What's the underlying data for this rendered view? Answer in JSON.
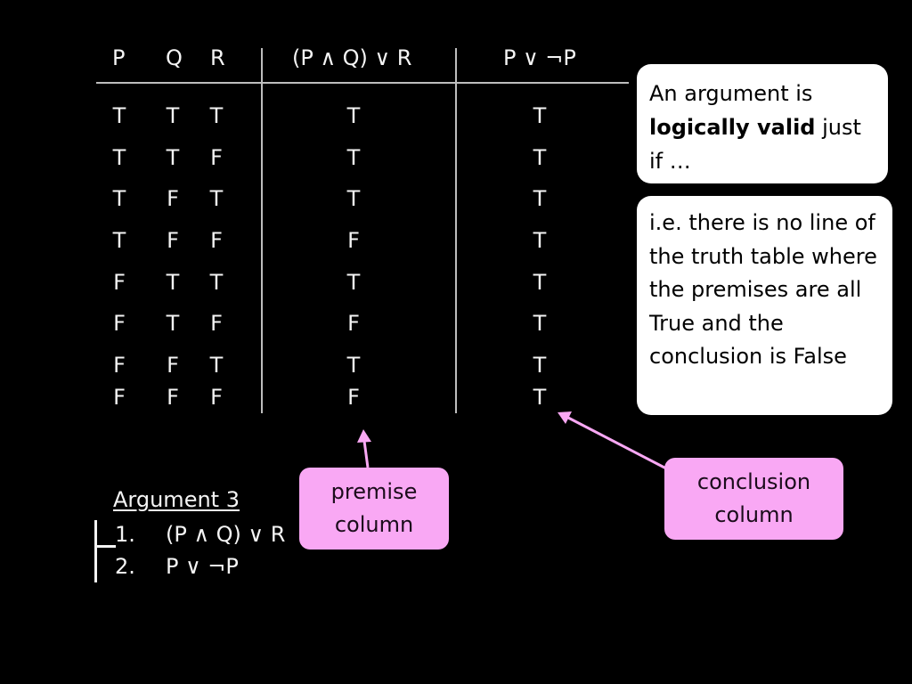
{
  "table": {
    "headers": {
      "p": "P",
      "q": "Q",
      "r": "R",
      "premise": "(P ∧ Q) ∨ R",
      "conclusion": "P ∨ ¬P"
    },
    "rows": [
      {
        "p": "T",
        "q": "T",
        "r": "T",
        "premise": "T",
        "conclusion": "T"
      },
      {
        "p": "T",
        "q": "T",
        "r": "F",
        "premise": "T",
        "conclusion": "T"
      },
      {
        "p": "T",
        "q": "F",
        "r": "T",
        "premise": "T",
        "conclusion": "T"
      },
      {
        "p": "T",
        "q": "F",
        "r": "F",
        "premise": "F",
        "conclusion": "T"
      },
      {
        "p": "F",
        "q": "T",
        "r": "T",
        "premise": "T",
        "conclusion": "T"
      },
      {
        "p": "F",
        "q": "T",
        "r": "F",
        "premise": "F",
        "conclusion": "T"
      },
      {
        "p": "F",
        "q": "F",
        "r": "T",
        "premise": "T",
        "conclusion": "T"
      },
      {
        "p": "F",
        "q": "F",
        "r": "F",
        "premise": "F",
        "conclusion": "T"
      }
    ]
  },
  "definition_box": {
    "text_before": "An argument is ",
    "bold": "logically valid",
    "text_after": " just if …"
  },
  "explanation_box": {
    "text": "i.e. there is no line of the truth table where the premises are all True and the conclusion is False"
  },
  "callouts": {
    "premise": {
      "line1": "premise",
      "line2": "column"
    },
    "conclusion": {
      "line1": "conclusion",
      "line2": "column"
    }
  },
  "argument": {
    "title": "Argument 3",
    "lines": [
      {
        "number": "1.",
        "formula": "(P ∧ Q) ∨ R"
      },
      {
        "number": "2.",
        "formula": "P ∨ ¬P"
      }
    ]
  },
  "colors": {
    "background": "#000000",
    "callout_fill": "#f9a8f4",
    "arrow": "#f9a8f4",
    "box_fill": "#ffffff"
  }
}
